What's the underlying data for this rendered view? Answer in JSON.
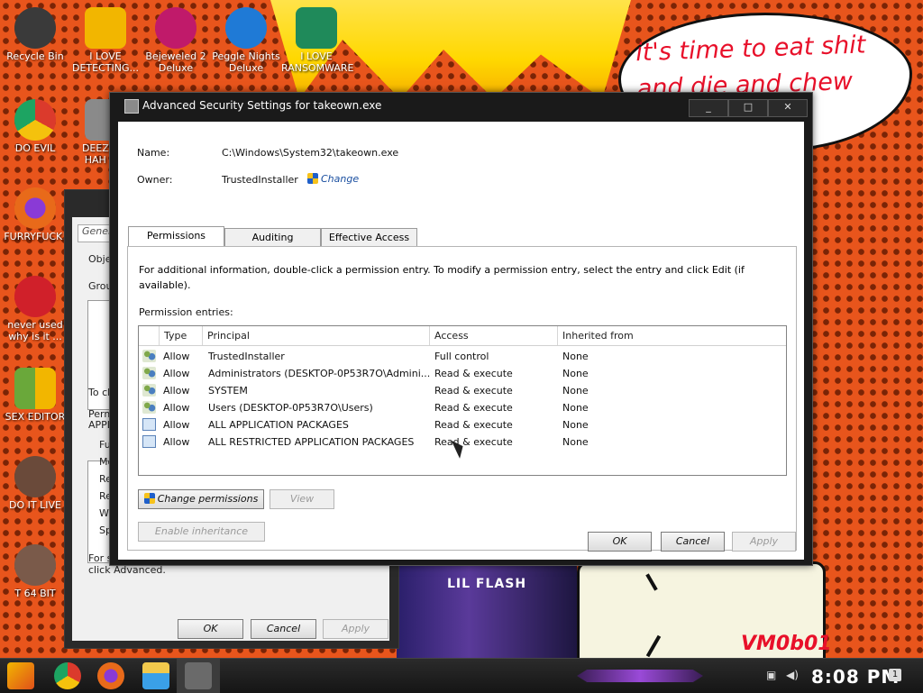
{
  "desktop": {
    "bubble_text": [
      "it's time to eat shit",
      "and die and chew"
    ],
    "album_text": "LIL FLASH",
    "watermark": "VM0b01",
    "icons": [
      {
        "label": "Recycle Bin",
        "icon": "recycle-bin-icon",
        "color": "#3a3a3a"
      },
      {
        "label": "I LOVE DETECTING...",
        "icon": "detect-it-easy-icon",
        "color": "#f2b600"
      },
      {
        "label": "Bejeweled 2 Deluxe",
        "icon": "bejeweled-icon",
        "color": "#c01a6a"
      },
      {
        "label": "Peggle Nights Deluxe",
        "icon": "peggle-icon",
        "color": "#1f7ad6"
      },
      {
        "label": "I LOVE RANSOMWARE",
        "icon": "publisher-icon",
        "color": "#1f8a5a"
      },
      {
        "label": "DO EVIL",
        "icon": "chrome-icon",
        "color": "#2f8f3a"
      },
      {
        "label": "DEEZ N... HAH G...",
        "icon": "file-icon",
        "color": "#8a8a8a"
      },
      {
        "label": "FURRYFUCK!",
        "icon": "firefox-icon",
        "color": "#e86a1a"
      },
      {
        "label": "never used why is it ...",
        "icon": "devcpp-icon",
        "color": "#d0202a"
      },
      {
        "label": "SEX EDITOR",
        "icon": "hxd-icon",
        "color": "#6aa83a"
      },
      {
        "label": "DO IT LIVE",
        "icon": "portrait-icon",
        "color": "#6a4a3a"
      },
      {
        "label": "T 64 BIT",
        "icon": "portrait-icon",
        "color": "#7a5a4a"
      }
    ]
  },
  "back_window": {
    "tab": "Gener",
    "frags": [
      "Obje",
      "Grou",
      "To ch",
      "Perm",
      "APPL",
      "Fu",
      "Mo",
      "Re",
      "Re",
      "W",
      "Sp",
      "For s",
      "click Advanced."
    ],
    "ok": "OK",
    "cancel": "Cancel",
    "apply": "Apply"
  },
  "dialog": {
    "title": "Advanced Security Settings for takeown.exe",
    "name_label": "Name:",
    "name_value": "C:\\Windows\\System32\\takeown.exe",
    "owner_label": "Owner:",
    "owner_value": "TrustedInstaller",
    "change_link": "Change",
    "tabs": [
      "Permissions",
      "Auditing",
      "Effective Access"
    ],
    "info": "For additional information, double-click a permission entry. To modify a permission entry, select the entry and click Edit (if available).",
    "entries_label": "Permission entries:",
    "columns": [
      "Type",
      "Principal",
      "Access",
      "Inherited from"
    ],
    "rows": [
      {
        "icon": "user",
        "type": "Allow",
        "principal": "TrustedInstaller",
        "access": "Full control",
        "inherited": "None"
      },
      {
        "icon": "user",
        "type": "Allow",
        "principal": "Administrators (DESKTOP-0P53R7O\\Admini...",
        "access": "Read & execute",
        "inherited": "None"
      },
      {
        "icon": "user",
        "type": "Allow",
        "principal": "SYSTEM",
        "access": "Read & execute",
        "inherited": "None"
      },
      {
        "icon": "user",
        "type": "Allow",
        "principal": "Users (DESKTOP-0P53R7O\\Users)",
        "access": "Read & execute",
        "inherited": "None"
      },
      {
        "icon": "pkg",
        "type": "Allow",
        "principal": "ALL APPLICATION PACKAGES",
        "access": "Read & execute",
        "inherited": "None"
      },
      {
        "icon": "pkg",
        "type": "Allow",
        "principal": "ALL RESTRICTED APPLICATION PACKAGES",
        "access": "Read & execute",
        "inherited": "None"
      }
    ],
    "change_permissions": "Change permissions",
    "view": "View",
    "enable_inheritance": "Enable inheritance",
    "ok": "OK",
    "cancel": "Cancel",
    "apply": "Apply",
    "caption_min": "_",
    "caption_max": "□",
    "caption_close": "✕"
  },
  "taskbar": {
    "time": "8:08 PM",
    "notification_count": "1"
  }
}
